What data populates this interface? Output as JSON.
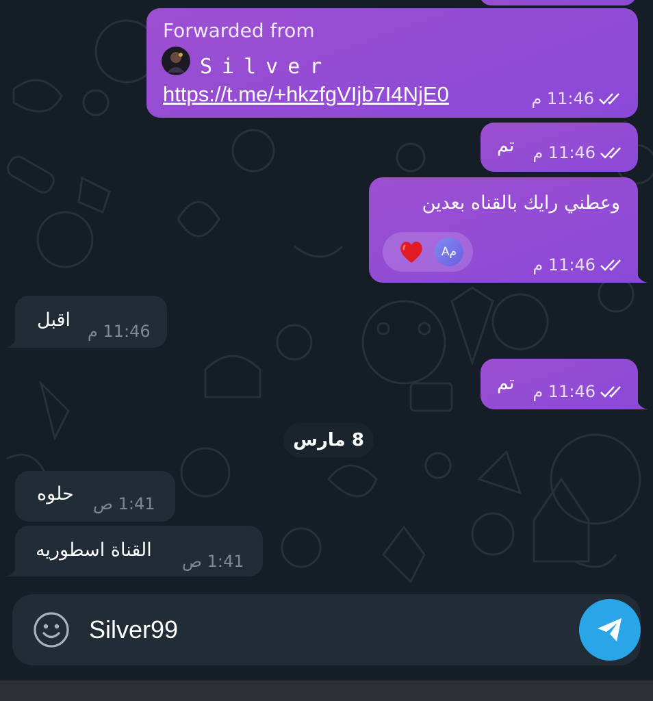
{
  "forwarded": {
    "label": "Forwarded from",
    "name": "Silver",
    "link": "https://t.me/+hkzfgVIjb7I4NjE0",
    "time": "11:46 م"
  },
  "messages": [
    {
      "text": "تم",
      "time": "11:46 م"
    },
    {
      "text": "وعطني رايك بالقناه بعدين",
      "time": "11:46 م",
      "reaction_user": "Aم"
    },
    {
      "text": "اقبل",
      "time": "11:46 م"
    },
    {
      "text": "تم",
      "time": "11:46 م"
    },
    {
      "text": "حلوه",
      "time": "1:41 ص"
    },
    {
      "text": "القناة اسطوريه",
      "time": "1:41 ص"
    }
  ],
  "date_divider": "8 مارس",
  "composer": {
    "value": "Silver99"
  },
  "colors": {
    "outgoing_bubble": "#9a4dd2",
    "incoming_bubble": "#222c37",
    "send_button": "#2aa5e8"
  }
}
